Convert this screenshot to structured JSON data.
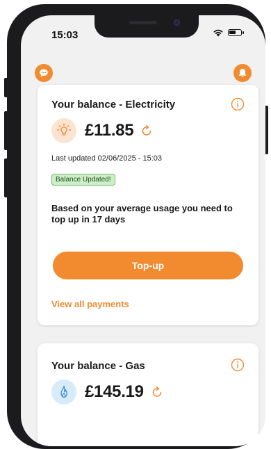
{
  "status_bar": {
    "time": "15:03"
  },
  "colors": {
    "accent": "#f28a30",
    "badge_bg": "#cdeec8",
    "badge_border": "#6db866"
  },
  "header": {
    "left_icon": "chat-bubble-icon",
    "right_icon": "bell-icon"
  },
  "electricity_card": {
    "title": "Your balance - Electricity",
    "icon": "lightbulb-icon",
    "balance": "£11.85",
    "last_updated": "Last updated 02/06/2025 - 15:03",
    "badge": "Balance Updated!",
    "usage_message": "Based on your average usage you need to top up in 17 days",
    "topup_label": "Top-up",
    "payments_link": "View all payments"
  },
  "gas_card": {
    "title": "Your balance - Gas",
    "icon": "flame-icon",
    "balance": "£145.19"
  }
}
